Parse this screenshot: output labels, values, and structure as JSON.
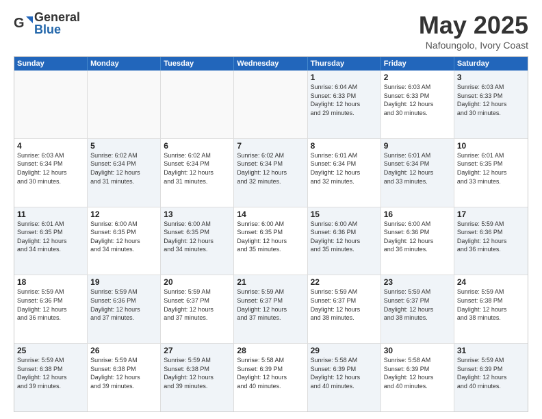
{
  "logo": {
    "general": "General",
    "blue": "Blue"
  },
  "title": {
    "month": "May 2025",
    "location": "Nafoungolo, Ivory Coast"
  },
  "header_days": [
    "Sunday",
    "Monday",
    "Tuesday",
    "Wednesday",
    "Thursday",
    "Friday",
    "Saturday"
  ],
  "rows": [
    [
      {
        "day": "",
        "text": "",
        "empty": true
      },
      {
        "day": "",
        "text": "",
        "empty": true
      },
      {
        "day": "",
        "text": "",
        "empty": true
      },
      {
        "day": "",
        "text": "",
        "empty": true
      },
      {
        "day": "1",
        "text": "Sunrise: 6:04 AM\nSunset: 6:33 PM\nDaylight: 12 hours\nand 29 minutes.",
        "shaded": true
      },
      {
        "day": "2",
        "text": "Sunrise: 6:03 AM\nSunset: 6:33 PM\nDaylight: 12 hours\nand 30 minutes."
      },
      {
        "day": "3",
        "text": "Sunrise: 6:03 AM\nSunset: 6:33 PM\nDaylight: 12 hours\nand 30 minutes.",
        "shaded": true
      }
    ],
    [
      {
        "day": "4",
        "text": "Sunrise: 6:03 AM\nSunset: 6:34 PM\nDaylight: 12 hours\nand 30 minutes."
      },
      {
        "day": "5",
        "text": "Sunrise: 6:02 AM\nSunset: 6:34 PM\nDaylight: 12 hours\nand 31 minutes.",
        "shaded": true
      },
      {
        "day": "6",
        "text": "Sunrise: 6:02 AM\nSunset: 6:34 PM\nDaylight: 12 hours\nand 31 minutes."
      },
      {
        "day": "7",
        "text": "Sunrise: 6:02 AM\nSunset: 6:34 PM\nDaylight: 12 hours\nand 32 minutes.",
        "shaded": true
      },
      {
        "day": "8",
        "text": "Sunrise: 6:01 AM\nSunset: 6:34 PM\nDaylight: 12 hours\nand 32 minutes."
      },
      {
        "day": "9",
        "text": "Sunrise: 6:01 AM\nSunset: 6:34 PM\nDaylight: 12 hours\nand 33 minutes.",
        "shaded": true
      },
      {
        "day": "10",
        "text": "Sunrise: 6:01 AM\nSunset: 6:35 PM\nDaylight: 12 hours\nand 33 minutes."
      }
    ],
    [
      {
        "day": "11",
        "text": "Sunrise: 6:01 AM\nSunset: 6:35 PM\nDaylight: 12 hours\nand 34 minutes.",
        "shaded": true
      },
      {
        "day": "12",
        "text": "Sunrise: 6:00 AM\nSunset: 6:35 PM\nDaylight: 12 hours\nand 34 minutes."
      },
      {
        "day": "13",
        "text": "Sunrise: 6:00 AM\nSunset: 6:35 PM\nDaylight: 12 hours\nand 34 minutes.",
        "shaded": true
      },
      {
        "day": "14",
        "text": "Sunrise: 6:00 AM\nSunset: 6:35 PM\nDaylight: 12 hours\nand 35 minutes."
      },
      {
        "day": "15",
        "text": "Sunrise: 6:00 AM\nSunset: 6:36 PM\nDaylight: 12 hours\nand 35 minutes.",
        "shaded": true
      },
      {
        "day": "16",
        "text": "Sunrise: 6:00 AM\nSunset: 6:36 PM\nDaylight: 12 hours\nand 36 minutes."
      },
      {
        "day": "17",
        "text": "Sunrise: 5:59 AM\nSunset: 6:36 PM\nDaylight: 12 hours\nand 36 minutes.",
        "shaded": true
      }
    ],
    [
      {
        "day": "18",
        "text": "Sunrise: 5:59 AM\nSunset: 6:36 PM\nDaylight: 12 hours\nand 36 minutes."
      },
      {
        "day": "19",
        "text": "Sunrise: 5:59 AM\nSunset: 6:36 PM\nDaylight: 12 hours\nand 37 minutes.",
        "shaded": true
      },
      {
        "day": "20",
        "text": "Sunrise: 5:59 AM\nSunset: 6:37 PM\nDaylight: 12 hours\nand 37 minutes."
      },
      {
        "day": "21",
        "text": "Sunrise: 5:59 AM\nSunset: 6:37 PM\nDaylight: 12 hours\nand 37 minutes.",
        "shaded": true
      },
      {
        "day": "22",
        "text": "Sunrise: 5:59 AM\nSunset: 6:37 PM\nDaylight: 12 hours\nand 38 minutes."
      },
      {
        "day": "23",
        "text": "Sunrise: 5:59 AM\nSunset: 6:37 PM\nDaylight: 12 hours\nand 38 minutes.",
        "shaded": true
      },
      {
        "day": "24",
        "text": "Sunrise: 5:59 AM\nSunset: 6:38 PM\nDaylight: 12 hours\nand 38 minutes."
      }
    ],
    [
      {
        "day": "25",
        "text": "Sunrise: 5:59 AM\nSunset: 6:38 PM\nDaylight: 12 hours\nand 39 minutes.",
        "shaded": true
      },
      {
        "day": "26",
        "text": "Sunrise: 5:59 AM\nSunset: 6:38 PM\nDaylight: 12 hours\nand 39 minutes."
      },
      {
        "day": "27",
        "text": "Sunrise: 5:59 AM\nSunset: 6:38 PM\nDaylight: 12 hours\nand 39 minutes.",
        "shaded": true
      },
      {
        "day": "28",
        "text": "Sunrise: 5:58 AM\nSunset: 6:39 PM\nDaylight: 12 hours\nand 40 minutes."
      },
      {
        "day": "29",
        "text": "Sunrise: 5:58 AM\nSunset: 6:39 PM\nDaylight: 12 hours\nand 40 minutes.",
        "shaded": true
      },
      {
        "day": "30",
        "text": "Sunrise: 5:58 AM\nSunset: 6:39 PM\nDaylight: 12 hours\nand 40 minutes."
      },
      {
        "day": "31",
        "text": "Sunrise: 5:59 AM\nSunset: 6:39 PM\nDaylight: 12 hours\nand 40 minutes.",
        "shaded": true
      }
    ]
  ]
}
